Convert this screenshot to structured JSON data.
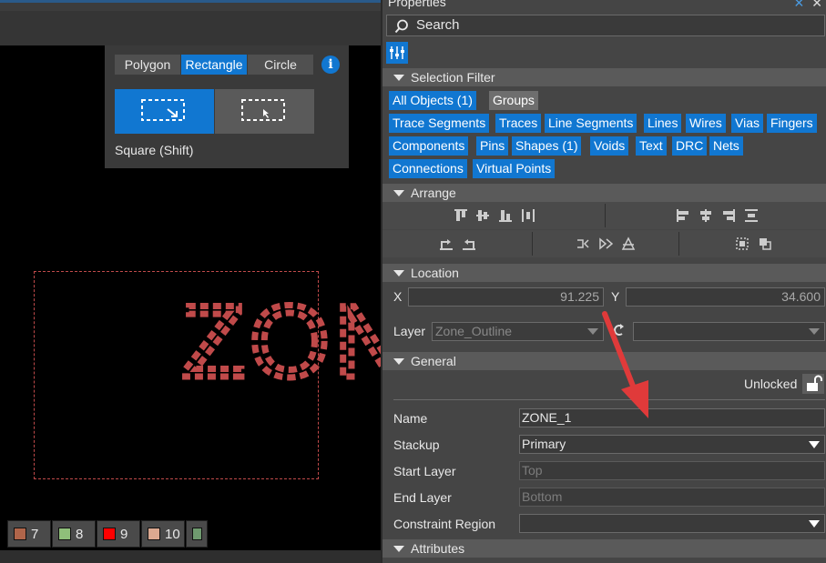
{
  "canvas": {
    "shape_tabs": [
      {
        "label": "Polygon",
        "active": false
      },
      {
        "label": "Rectangle",
        "active": true
      },
      {
        "label": "Circle",
        "active": false
      }
    ],
    "info_icon": "i",
    "mode_label": "Square (Shift)",
    "zone_label": "ZONE",
    "color_swatches": [
      {
        "num": "7",
        "color": "#b0654a"
      },
      {
        "num": "8",
        "color": "#8fbf7a"
      },
      {
        "num": "9",
        "color": "#ff0000"
      },
      {
        "num": "10",
        "color": "#dba890"
      },
      {
        "num": "",
        "color": "#6f9a6f"
      }
    ]
  },
  "panel": {
    "title": "Properties",
    "controls": [
      "pin-icon",
      "close-icon"
    ],
    "search": {
      "placeholder": "Search",
      "value": ""
    },
    "selection_filter": {
      "title": "Selection Filter",
      "rows": [
        [
          {
            "label": "All Objects (1)",
            "active": true
          },
          {
            "label": "Groups",
            "active": false
          }
        ],
        [
          {
            "label": "Trace Segments",
            "active": true
          },
          {
            "label": "Traces",
            "active": true
          },
          {
            "label": "Line Segments",
            "active": true
          },
          {
            "label": "Lines",
            "active": true
          },
          {
            "label": "Wires",
            "active": true
          },
          {
            "label": "Vias",
            "active": true
          },
          {
            "label": "Fingers",
            "active": true
          }
        ],
        [
          {
            "label": "Components",
            "active": true
          },
          {
            "label": "Pins",
            "active": true
          },
          {
            "label": "Shapes (1)",
            "active": true
          },
          {
            "label": "Voids",
            "active": true
          },
          {
            "label": "Text",
            "active": true
          },
          {
            "label": "DRC",
            "active": true
          },
          {
            "label": "Nets",
            "active": true
          }
        ],
        [
          {
            "label": "Connections",
            "active": true
          },
          {
            "label": "Virtual Points",
            "active": true
          }
        ]
      ]
    },
    "arrange": {
      "title": "Arrange"
    },
    "location": {
      "title": "Location",
      "x_label": "X",
      "x_value": "91.225",
      "y_label": "Y",
      "y_value": "34.600",
      "layer_label": "Layer",
      "layer_value": "Zone_Outline",
      "layer2_value": ""
    },
    "general": {
      "title": "General",
      "lock_status": "Unlocked",
      "fields": [
        {
          "label": "Name",
          "value": "ZONE_1",
          "disabled": false,
          "dropdown": false
        },
        {
          "label": "Stackup",
          "value": "Primary",
          "disabled": false,
          "dropdown": true
        },
        {
          "label": "Start Layer",
          "value": "Top",
          "disabled": true,
          "dropdown": false
        },
        {
          "label": "End Layer",
          "value": "Bottom",
          "disabled": true,
          "dropdown": false
        },
        {
          "label": "Constraint Region",
          "value": "",
          "disabled": false,
          "dropdown": true
        }
      ]
    },
    "attributes": {
      "title": "Attributes"
    }
  },
  "colors": {
    "accent": "#1177d1",
    "annotation_arrow": "#e03a3a",
    "zone": "#c04a4a"
  }
}
